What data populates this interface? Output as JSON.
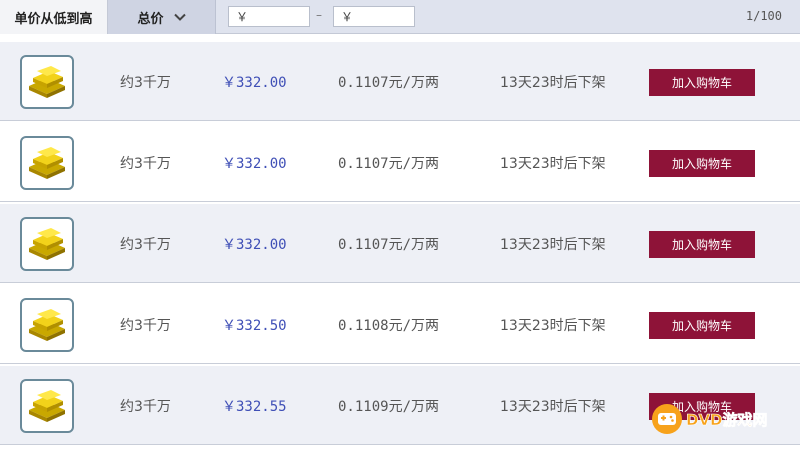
{
  "toolbar": {
    "sort_unit_label": "单价从低到高",
    "sort_total_label": "总价",
    "price_min_value": "￥",
    "price_max_value": "￥",
    "range_separator": "–",
    "pager": "1/100"
  },
  "listings": [
    {
      "icon": "gold-bars-icon",
      "amount": "约3千万",
      "price": "￥332.00",
      "unit_price": "0.1107元/万两",
      "remaining": "13天23时后下架",
      "cart_label": "加入购物车"
    },
    {
      "icon": "gold-bars-icon",
      "amount": "约3千万",
      "price": "￥332.00",
      "unit_price": "0.1107元/万两",
      "remaining": "13天23时后下架",
      "cart_label": "加入购物车"
    },
    {
      "icon": "gold-bars-icon",
      "amount": "约3千万",
      "price": "￥332.00",
      "unit_price": "0.1107元/万两",
      "remaining": "13天23时后下架",
      "cart_label": "加入购物车"
    },
    {
      "icon": "gold-bars-icon",
      "amount": "约3千万",
      "price": "￥332.50",
      "unit_price": "0.1108元/万两",
      "remaining": "13天23时后下架",
      "cart_label": "加入购物车"
    },
    {
      "icon": "gold-bars-icon",
      "amount": "约3千万",
      "price": "￥332.55",
      "unit_price": "0.1109元/万两",
      "remaining": "13天23时后下架",
      "cart_label": "加入购物车"
    }
  ],
  "watermark": {
    "text": "DVD游戏网"
  },
  "colors": {
    "cart_button": "#8e1338",
    "price": "#3f4fb6",
    "header": "#dfe3ee",
    "row_alt": "#eef0f6"
  }
}
